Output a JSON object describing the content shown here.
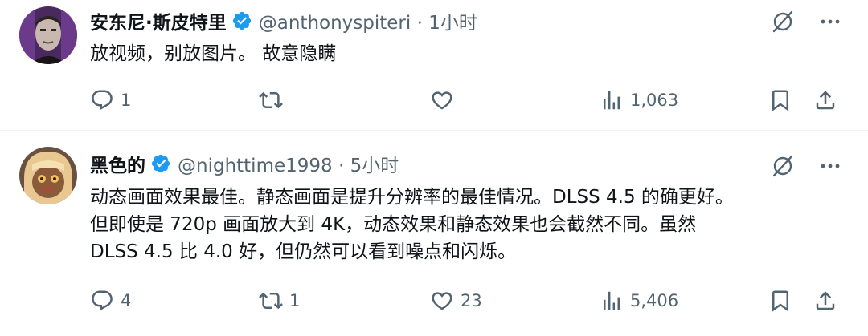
{
  "tweets": [
    {
      "name": "安东尼·斯皮特里",
      "handle_time": "@anthonyspiteri · 1小时",
      "lines": [
        "放视频，别放图片。 故意隐瞒"
      ],
      "replies": "1",
      "retweets": "",
      "likes": "",
      "views": "1,063",
      "icons": [
        "verified-badge-icon",
        "grok-icon",
        "more-icon",
        "reply-icon",
        "retweet-icon",
        "like-icon",
        "views-icon",
        "bookmark-icon",
        "share-icon"
      ]
    },
    {
      "name": "黑色的",
      "handle_time": "@nighttime1998 · 5小时",
      "lines": [
        "动态画面效果最佳。静态画面是提升分辨率的最佳情况。DLSS 4.5 的确更好。",
        "但即使是 720p 画面放大到 4K，动态效果和静态效果也会截然不同。虽然",
        "DLSS 4.5 比 4.0 好，但仍然可以看到噪点和闪烁。"
      ],
      "replies": "4",
      "retweets": "1",
      "likes": "23",
      "views": "5,406",
      "icons": [
        "verified-badge-icon",
        "grok-icon",
        "more-icon",
        "reply-icon",
        "retweet-icon",
        "like-icon",
        "views-icon",
        "bookmark-icon",
        "share-icon"
      ]
    }
  ],
  "colors": {
    "text": "#0f1419",
    "secondary": "#536471",
    "verified": "#1d9bf0",
    "divider": "#eff3f4"
  }
}
